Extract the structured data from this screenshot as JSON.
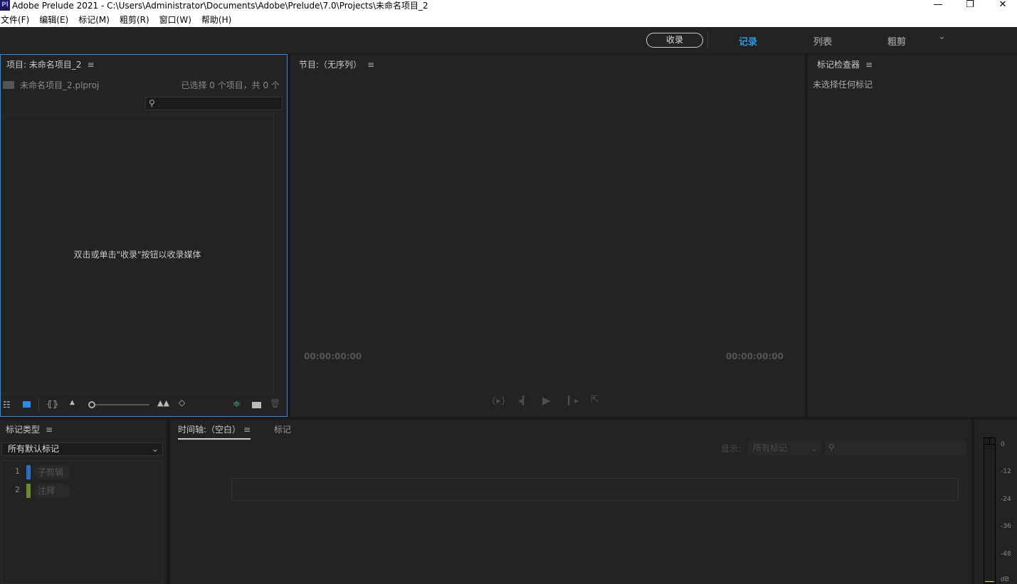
{
  "window": {
    "logo": "Pl",
    "title": "Adobe Prelude 2021 - C:\\Users\\Administrator\\Documents\\Adobe\\Prelude\\7.0\\Projects\\未命名项目_2",
    "minimize": "—",
    "restore": "❐",
    "close": "✕"
  },
  "menu": [
    "文件(F)",
    "编辑(E)",
    "标记(M)",
    "粗剪(R)",
    "窗口(W)",
    "帮助(H)"
  ],
  "workspace": {
    "ingest": "收录",
    "tabs": [
      "记录",
      "列表",
      "粗剪"
    ],
    "active": "记录",
    "more": "⌄",
    "accent": "#2d9ae0"
  },
  "project": {
    "title": "项目: 未命名项目_2",
    "menu": "≡",
    "file": "未命名项目_2.plproj",
    "selection": "已选择 0 个项目，共 0 个",
    "search_placeholder": "",
    "empty_hint": "双击或单击\"收录\"按钮以收录媒体",
    "zoom_fraction": 0
  },
  "program": {
    "title": "节目:（无序列）",
    "menu": "≡",
    "tc_in": "00:00:00:00",
    "tc_out": "00:00:00:00"
  },
  "inspector": {
    "title": "标记检查器",
    "menu": "≡",
    "empty": "未选择任何标记"
  },
  "marker_types": {
    "title": "标记类型",
    "menu": "≡",
    "filter": "所有默认标记",
    "items": [
      {
        "num": "1",
        "label": "子剪辑",
        "color": "#2a6fc4"
      },
      {
        "num": "2",
        "label": "注释",
        "color": "#6f8a2e"
      }
    ]
  },
  "timeline": {
    "tabs": [
      "时间轴:（空白）",
      "标记"
    ],
    "menu": "≡",
    "show_label": "显示:",
    "show_value": "所有标记"
  },
  "meter": {
    "labels": [
      "0",
      "-12",
      "-24",
      "-36",
      "-48",
      "dB"
    ]
  }
}
